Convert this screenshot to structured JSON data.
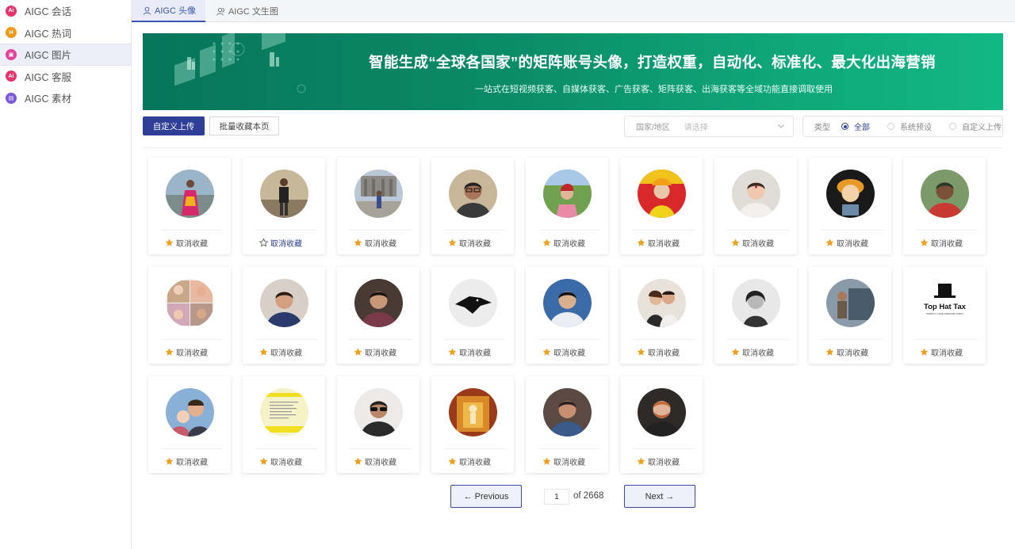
{
  "sidebar": {
    "items": [
      {
        "label": "AIGC 会话",
        "icon": "chat-icon",
        "color": "#e8336b",
        "glyph": "Ai",
        "active": false
      },
      {
        "label": "AIGC 热词",
        "icon": "hotword-icon",
        "color": "#f29a1c",
        "glyph": "H",
        "active": false
      },
      {
        "label": "AIGC 图片",
        "icon": "image-icon",
        "color": "#e0449a",
        "glyph": "▣",
        "active": true
      },
      {
        "label": "AIGC 客服",
        "icon": "service-icon",
        "color": "#e8336b",
        "glyph": "Ai",
        "active": false
      },
      {
        "label": "AIGC 素材",
        "icon": "material-icon",
        "color": "#7a5ad8",
        "glyph": "▤",
        "active": false
      }
    ]
  },
  "tabs": [
    {
      "label": "AIGC 头像",
      "icon": "user-icon",
      "active": true
    },
    {
      "label": "AIGC 文生图",
      "icon": "users-icon",
      "active": false
    }
  ],
  "banner": {
    "title": "智能生成“全球各国家”的矩阵账号头像，打造权重，自动化、标准化、最大化出海营销",
    "subtitle": "一站式在短视频获客、自媒体获客、广告获客、矩阵获客、出海获客等全域功能直接调取使用"
  },
  "toolbar": {
    "upload_label": "自定义上传",
    "batch_label": "批量收藏本页",
    "country_label": "国家/地区",
    "country_placeholder": "请选择",
    "type_label": "类型",
    "type_options": [
      {
        "label": "全部",
        "checked": true
      },
      {
        "label": "系统预设",
        "checked": false
      },
      {
        "label": "自定义上传",
        "checked": false
      }
    ]
  },
  "cards": [
    {
      "fav_label": "取消收藏",
      "starred": true,
      "avatar": "woman-colorful-dress"
    },
    {
      "fav_label": "取消收藏",
      "starred": false,
      "avatar": "man-standing-outdoor"
    },
    {
      "fav_label": "取消收藏",
      "starred": true,
      "avatar": "person-at-landmark"
    },
    {
      "fav_label": "取消收藏",
      "starred": true,
      "avatar": "man-with-glasses"
    },
    {
      "fav_label": "取消收藏",
      "starred": true,
      "avatar": "girl-in-garden"
    },
    {
      "fav_label": "取消收藏",
      "starred": true,
      "avatar": "man-colorful-costume"
    },
    {
      "fav_label": "取消收藏",
      "starred": true,
      "avatar": "baby-portrait"
    },
    {
      "fav_label": "取消收藏",
      "starred": true,
      "avatar": "cartoon-figure"
    },
    {
      "fav_label": "取消收藏",
      "starred": true,
      "avatar": "man-in-red-shirt"
    },
    {
      "fav_label": "取消收藏",
      "starred": true,
      "avatar": "family-collage"
    },
    {
      "fav_label": "取消收藏",
      "starred": true,
      "avatar": "woman-smiling"
    },
    {
      "fav_label": "取消收藏",
      "starred": true,
      "avatar": "woman-in-cafe"
    },
    {
      "fav_label": "取消收藏",
      "starred": true,
      "avatar": "wolf-logo"
    },
    {
      "fav_label": "取消收藏",
      "starred": true,
      "avatar": "man-blue-background"
    },
    {
      "fav_label": "取消收藏",
      "starred": true,
      "avatar": "couple-photo"
    },
    {
      "fav_label": "取消收藏",
      "starred": true,
      "avatar": "woman-black-white"
    },
    {
      "fav_label": "取消收藏",
      "starred": true,
      "avatar": "man-by-truck"
    },
    {
      "fav_label": "取消收藏",
      "starred": true,
      "avatar": "top-hat-logo",
      "logo_text": "Top Hat Tax",
      "logo_small": "DARRYL K. HAGE, ENROLLED AGENT"
    },
    {
      "fav_label": "取消收藏",
      "starred": true,
      "avatar": "man-with-baby"
    },
    {
      "fav_label": "取消收藏",
      "starred": true,
      "avatar": "yellow-document"
    },
    {
      "fav_label": "取消收藏",
      "starred": true,
      "avatar": "man-sunglasses"
    },
    {
      "fav_label": "取消收藏",
      "starred": true,
      "avatar": "golden-temple"
    },
    {
      "fav_label": "取消收藏",
      "starred": true,
      "avatar": "man-in-polo"
    },
    {
      "fav_label": "取消收藏",
      "starred": true,
      "avatar": "bearded-man"
    }
  ],
  "pagination": {
    "prev_label": "← Previous",
    "next_label": "Next →",
    "page": "1",
    "of_label": "of 2668"
  },
  "colors": {
    "primary": "#2f3f98",
    "banner_green": "#0a8a66",
    "star": "#f0a020"
  }
}
